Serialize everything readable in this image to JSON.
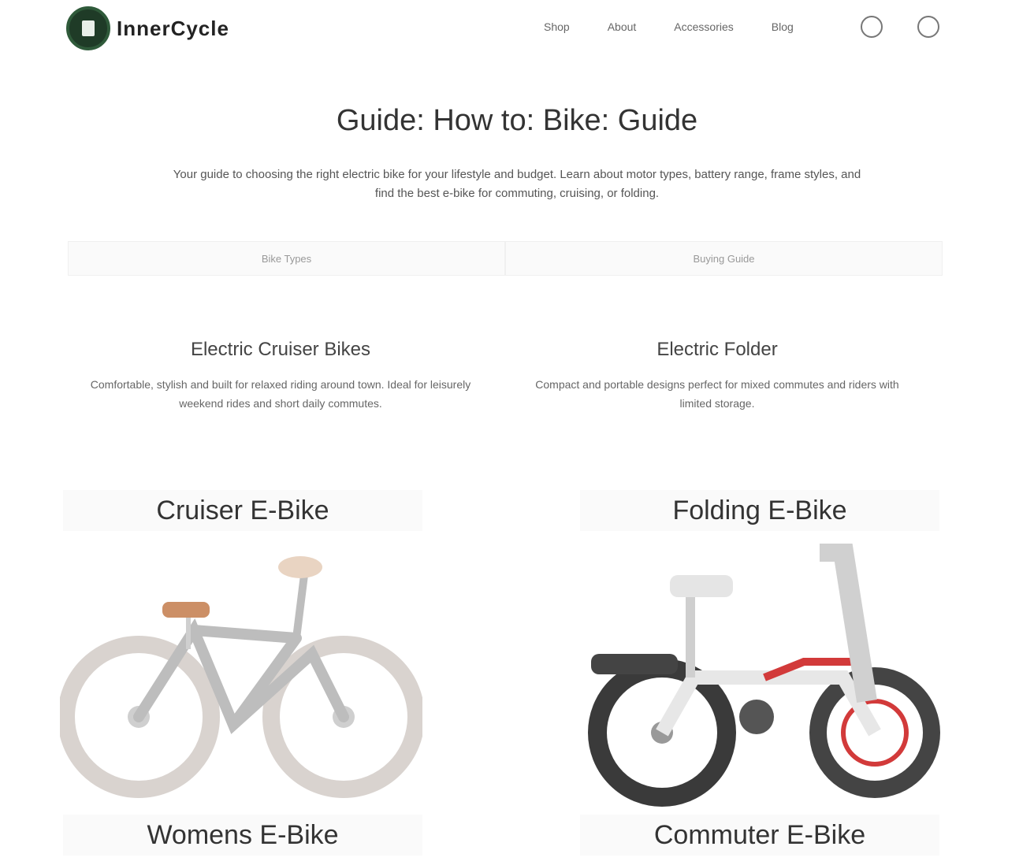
{
  "header": {
    "logo_text": "InnerCycle",
    "nav": [
      "Shop",
      "About",
      "Accessories",
      "Blog"
    ],
    "icons": [
      "search-icon",
      "cart-icon"
    ]
  },
  "hero": {
    "title": "Guide: How to: Bike: Guide",
    "intro": "Your guide to choosing the right electric bike for your lifestyle and budget. Learn about motor types, battery range, frame styles, and find the best e-bike for commuting, cruising, or folding."
  },
  "tabs": [
    "Bike Types",
    "Buying Guide"
  ],
  "sections": [
    {
      "title": "Electric Cruiser Bikes",
      "text": "Comfortable, stylish and built for relaxed riding around town. Ideal for leisurely weekend rides and short daily commutes."
    },
    {
      "title": "Electric Folder",
      "text": "Compact and portable designs perfect for mixed commutes and riders with limited storage."
    }
  ],
  "cards": [
    {
      "title": "Cruiser E-Bike",
      "caption": "Womens E-Bike"
    },
    {
      "title": "Folding E-Bike",
      "caption": "Commuter E-Bike"
    }
  ],
  "colors": {
    "accent": "#d23a3a",
    "logo": "#1f3b27"
  }
}
